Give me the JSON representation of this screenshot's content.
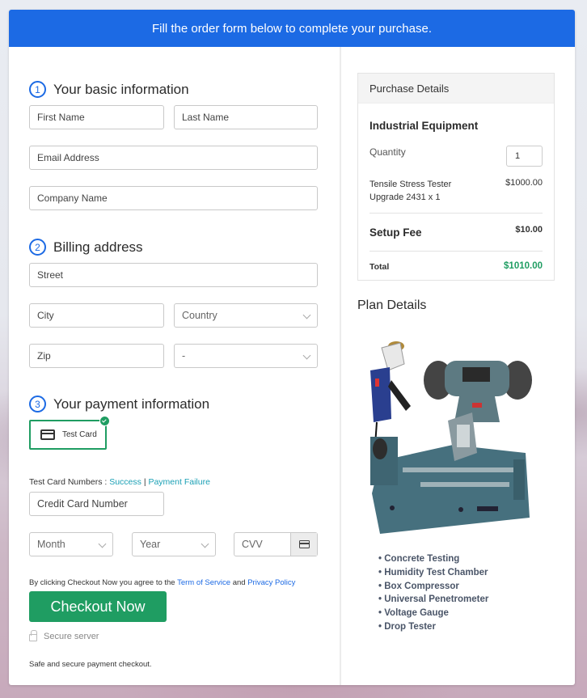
{
  "banner": {
    "text": "Fill the order form below to complete your purchase."
  },
  "sections": {
    "basic": {
      "step": "1",
      "title": "Your basic information"
    },
    "billing": {
      "step": "2",
      "title": "Billing address"
    },
    "payment": {
      "step": "3",
      "title": "Your payment information"
    }
  },
  "fields": {
    "first_name": "First Name",
    "last_name": "Last Name",
    "email": "Email Address",
    "company": "Company Name",
    "street": "Street",
    "city": "City",
    "country": "Country",
    "zip": "Zip",
    "state": "-",
    "card_number": "Credit Card Number",
    "month": "Month",
    "year": "Year",
    "cvv": "CVV"
  },
  "payment": {
    "card_option": "Test Card",
    "test_numbers_label": "Test Card Numbers :",
    "success_link": "Success",
    "separator": "|",
    "failure_link": "Payment Failure"
  },
  "footer": {
    "agree_prefix": "By clicking Checkout Now you agree to the",
    "terms_link": "Term of Service",
    "and": "and",
    "privacy_link": "Privacy Policy",
    "checkout_button": "Checkout Now",
    "secure_server": "Secure server",
    "safe_text": "Safe and secure payment checkout."
  },
  "purchase": {
    "header": "Purchase Details",
    "product": "Industrial Equipment",
    "quantity_label": "Quantity",
    "quantity_value": "1",
    "item_name": "Tensile Stress Tester Upgrade 2431 x 1",
    "item_price": "$1000.00",
    "setup_fee_label": "Setup Fee",
    "setup_fee_value": "$10.00",
    "total_label": "Total",
    "total_value": "$1010.00"
  },
  "plan": {
    "title": "Plan Details",
    "image_alt": "Industrial equipment: angle grinder, bench grinder, CNC lathe bed",
    "features": [
      "Concrete Testing",
      "Humidity Test Chamber",
      "Box Compressor",
      "Universal Penetrometer",
      "Voltage Gauge",
      "Drop Tester"
    ]
  },
  "colors": {
    "brand_blue": "#1c6ae4",
    "success_green": "#1f9d62",
    "link_teal": "#1aa0b5"
  }
}
